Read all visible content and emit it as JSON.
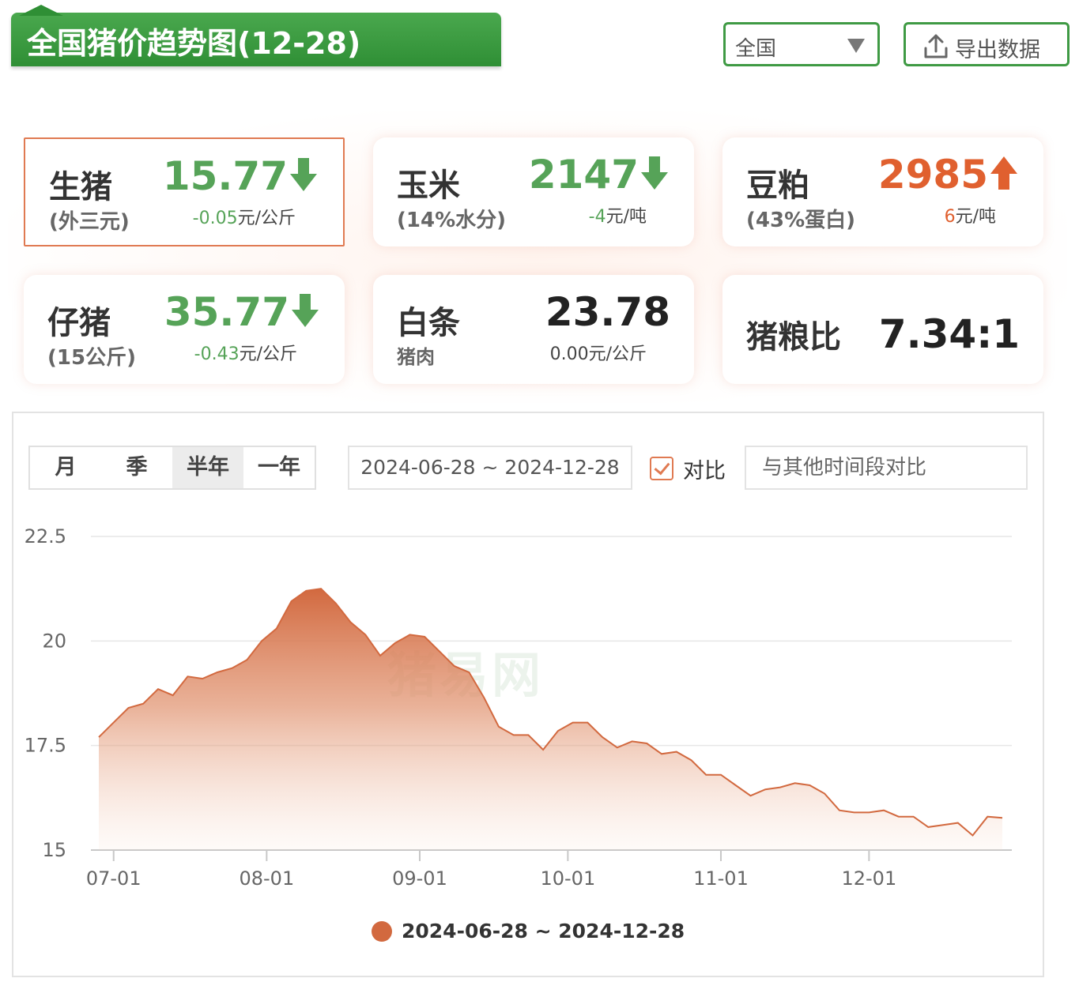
{
  "header": {
    "title": "全国猪价趋势图(12-28)",
    "region_value": "全国",
    "export_label": "导出数据"
  },
  "cards": [
    {
      "id": "live-hog",
      "name": "生猪",
      "sub": "(外三元)",
      "price": "15.77",
      "direction": "down",
      "delta": "-0.05",
      "unit": "元/公斤"
    },
    {
      "id": "corn",
      "name": "玉米",
      "sub": "(14%水分)",
      "price": "2147",
      "direction": "down",
      "delta": "-4",
      "unit": "元/吨"
    },
    {
      "id": "soymeal",
      "name": "豆粕",
      "sub": "(43%蛋白)",
      "price": "2985",
      "direction": "up",
      "delta": "6",
      "unit": "元/吨"
    },
    {
      "id": "piglet",
      "name": "仔猪",
      "sub": "(15公斤)",
      "price": "35.77",
      "direction": "down",
      "delta": "-0.43",
      "unit": "元/公斤"
    },
    {
      "id": "pork",
      "name": "白条",
      "sub": "猪肉",
      "price": "23.78",
      "direction": "none",
      "delta": "0.00",
      "unit": "元/公斤"
    },
    {
      "id": "ratio",
      "name": "猪粮比",
      "sub": "",
      "price": "7.34:1",
      "direction": "none",
      "delta": "",
      "unit": ""
    }
  ],
  "controls": {
    "period_tabs": [
      "月",
      "季",
      "半年",
      "一年"
    ],
    "selected_period": "半年",
    "date_range": "2024-06-28 ~ 2024-12-28",
    "compare_label": "对比",
    "compare_checked": true,
    "compare_placeholder": "与其他时间段对比"
  },
  "watermark": "猪易网",
  "colors": {
    "brand_green": "#3f9a44",
    "up": "#e0602f",
    "down": "#56a358",
    "series": "#d2693f"
  },
  "chart_data": {
    "type": "area",
    "title": "",
    "xlabel": "",
    "ylabel": "",
    "ylim": [
      15,
      22.5
    ],
    "yticks": [
      15,
      17.5,
      20,
      22.5
    ],
    "xticks": [
      "2024-07-01",
      "2024-08-01",
      "2024-09-01",
      "2024-10-01",
      "2024-11-01",
      "2024-12-01"
    ],
    "xtick_labels": [
      "07-01",
      "08-01",
      "09-01",
      "10-01",
      "11-01",
      "12-01"
    ],
    "xlim": [
      "2024-06-28",
      "2024-12-28"
    ],
    "grid": true,
    "legend": "bottom",
    "series": [
      {
        "name": "2024-06-28 ~ 2024-12-28",
        "color": "#d2693f",
        "x": [
          "2024-06-28",
          "2024-07-01",
          "2024-07-04",
          "2024-07-07",
          "2024-07-10",
          "2024-07-13",
          "2024-07-16",
          "2024-07-19",
          "2024-07-22",
          "2024-07-25",
          "2024-07-28",
          "2024-07-31",
          "2024-08-03",
          "2024-08-06",
          "2024-08-09",
          "2024-08-12",
          "2024-08-15",
          "2024-08-18",
          "2024-08-21",
          "2024-08-24",
          "2024-08-27",
          "2024-08-30",
          "2024-09-02",
          "2024-09-05",
          "2024-09-08",
          "2024-09-11",
          "2024-09-14",
          "2024-09-17",
          "2024-09-20",
          "2024-09-23",
          "2024-09-26",
          "2024-09-29",
          "2024-10-02",
          "2024-10-05",
          "2024-10-08",
          "2024-10-11",
          "2024-10-14",
          "2024-10-17",
          "2024-10-20",
          "2024-10-23",
          "2024-10-26",
          "2024-10-29",
          "2024-11-01",
          "2024-11-04",
          "2024-11-07",
          "2024-11-10",
          "2024-11-13",
          "2024-11-16",
          "2024-11-19",
          "2024-11-22",
          "2024-11-25",
          "2024-11-28",
          "2024-12-01",
          "2024-12-04",
          "2024-12-07",
          "2024-12-10",
          "2024-12-13",
          "2024-12-16",
          "2024-12-19",
          "2024-12-22",
          "2024-12-25",
          "2024-12-28"
        ],
        "values": [
          17.7,
          18.05,
          18.4,
          18.5,
          18.85,
          18.7,
          19.15,
          19.1,
          19.25,
          19.35,
          19.55,
          20.0,
          20.3,
          20.95,
          21.2,
          21.25,
          20.9,
          20.45,
          20.15,
          19.65,
          19.95,
          20.15,
          20.1,
          19.75,
          19.4,
          19.25,
          18.65,
          17.95,
          17.75,
          17.75,
          17.4,
          17.85,
          18.05,
          18.05,
          17.7,
          17.45,
          17.6,
          17.55,
          17.3,
          17.35,
          17.15,
          16.8,
          16.8,
          16.55,
          16.3,
          16.45,
          16.5,
          16.6,
          16.55,
          16.35,
          15.95,
          15.9,
          15.9,
          15.95,
          15.8,
          15.8,
          15.55,
          15.6,
          15.65,
          15.35,
          15.8,
          15.77
        ]
      }
    ]
  }
}
